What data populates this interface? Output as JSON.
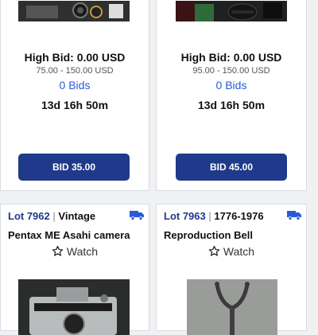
{
  "lots": [
    {
      "high_bid": "High Bid: 0.00 USD",
      "estimate": "75.00 - 150.00 USD",
      "bids": "0 Bids",
      "time_left": "13d 16h 50m",
      "bid_button": "BID 35.00"
    },
    {
      "high_bid": "High Bid: 0.00 USD",
      "estimate": "95.00 - 150.00 USD",
      "bids": "0 Bids",
      "time_left": "13d 16h 50m",
      "bid_button": "BID 45.00"
    },
    {
      "lot_number": "Lot 7962",
      "separator": "|",
      "category": "Vintage",
      "title": "Pentax ME Asahi camera",
      "watch_label": "Watch",
      "shipping_icon": "truck-icon"
    },
    {
      "lot_number": "Lot 7963",
      "separator": "|",
      "category": "1776-1976",
      "title": "Reproduction Bell",
      "watch_label": "Watch",
      "shipping_icon": "truck-icon"
    }
  ],
  "colors": {
    "accent": "#1f3a8a",
    "bid_count": "#2a5bd7",
    "background": "#f0f1f3"
  }
}
